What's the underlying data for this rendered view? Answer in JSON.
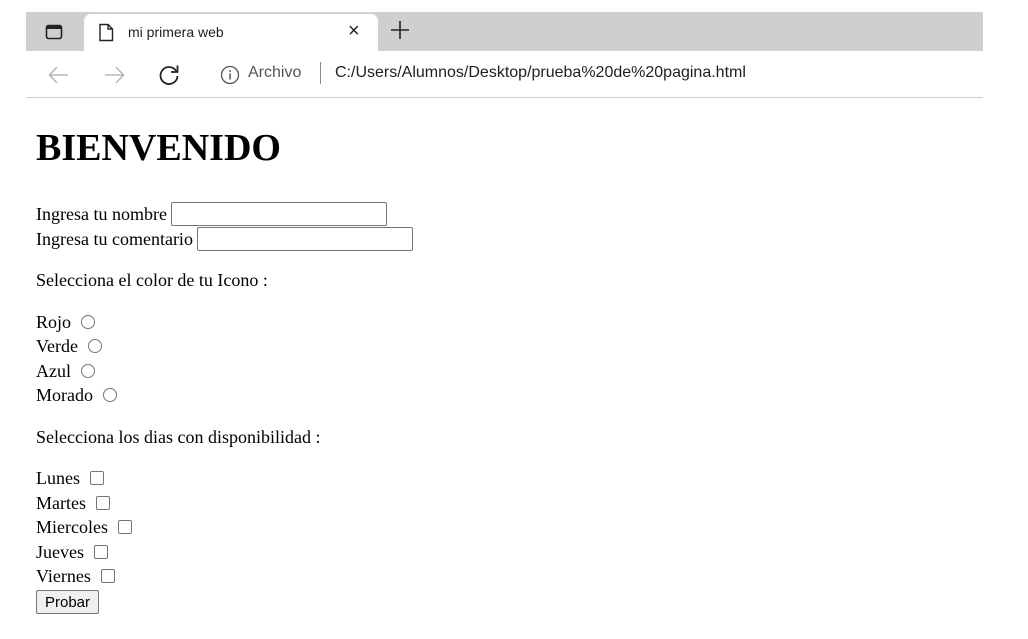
{
  "browser": {
    "tab_title": "mi primera web",
    "tab_close": "×",
    "address": {
      "origin_label": "Archivo",
      "url": "C:/Users/Alumnos/Desktop/prueba%20de%20pagina.html"
    }
  },
  "page": {
    "heading": "BIENVENIDO",
    "name_label": "Ingresa tu nombre",
    "name_value": "",
    "comment_label": "Ingresa tu comentario",
    "comment_value": "",
    "color_prompt": "Selecciona el color de tu Icono :",
    "colors": [
      {
        "label": "Rojo",
        "checked": false
      },
      {
        "label": "Verde",
        "checked": false
      },
      {
        "label": "Azul",
        "checked": false
      },
      {
        "label": "Morado",
        "checked": false
      }
    ],
    "days_prompt": "Selecciona los dias con disponibilidad :",
    "days": [
      {
        "label": "Lunes",
        "checked": false
      },
      {
        "label": "Martes",
        "checked": false
      },
      {
        "label": "Miercoles",
        "checked": false
      },
      {
        "label": "Jueves",
        "checked": false
      },
      {
        "label": "Viernes",
        "checked": false
      }
    ],
    "submit_label": "Probar"
  },
  "icons": {
    "tab_actions": "tab-actions-icon",
    "page": "page-icon",
    "new_tab": "plus-icon",
    "back": "arrow-left-icon",
    "forward": "arrow-right-icon",
    "refresh": "refresh-icon",
    "info": "info-icon"
  },
  "colors": {
    "tabstrip": "#cfcfcf",
    "disabled_icon": "#b8b8b8",
    "border": "#767676"
  }
}
